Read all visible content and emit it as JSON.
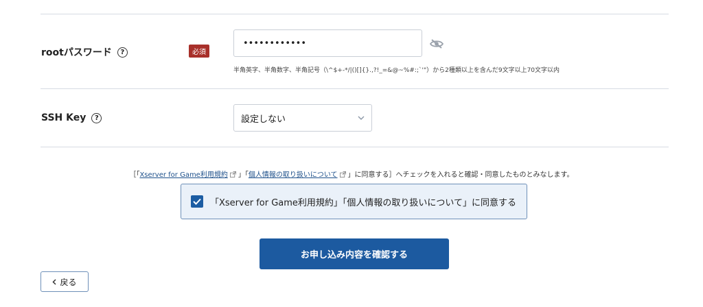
{
  "root_password": {
    "label": "rootパスワード",
    "help_symbol": "?",
    "required_badge": "必須",
    "value": "••••••••••••",
    "hint": "半角英字、半角数字、半角記号（\\^$+-*/|()[]{}.,?!_=&@~%#:;`'\"）から2種類以上を含んだ9文字以上70文字以内",
    "visibility_icon": "eye-slash-icon"
  },
  "ssh_key": {
    "label": "SSH Key",
    "help_symbol": "?",
    "selected": "設定しない"
  },
  "terms_notice": {
    "prefix": "［「",
    "terms_link": "Xserver for Game利用規約",
    "middle": "」「",
    "privacy_link": "個人情報の取り扱いについて",
    "suffix": "」に同意する］へチェックを入れると確認・同意したものとみなします。"
  },
  "agree_checkbox": {
    "checked": true,
    "label": "「Xserver for Game利用規約」「個人情報の取り扱いについて」に同意する"
  },
  "buttons": {
    "confirm": "お申し込み内容を確認する",
    "back": "戻る"
  },
  "colors": {
    "primary": "#1c5aa0",
    "required": "#a8302a",
    "agree_bg": "#eaf1f9"
  }
}
